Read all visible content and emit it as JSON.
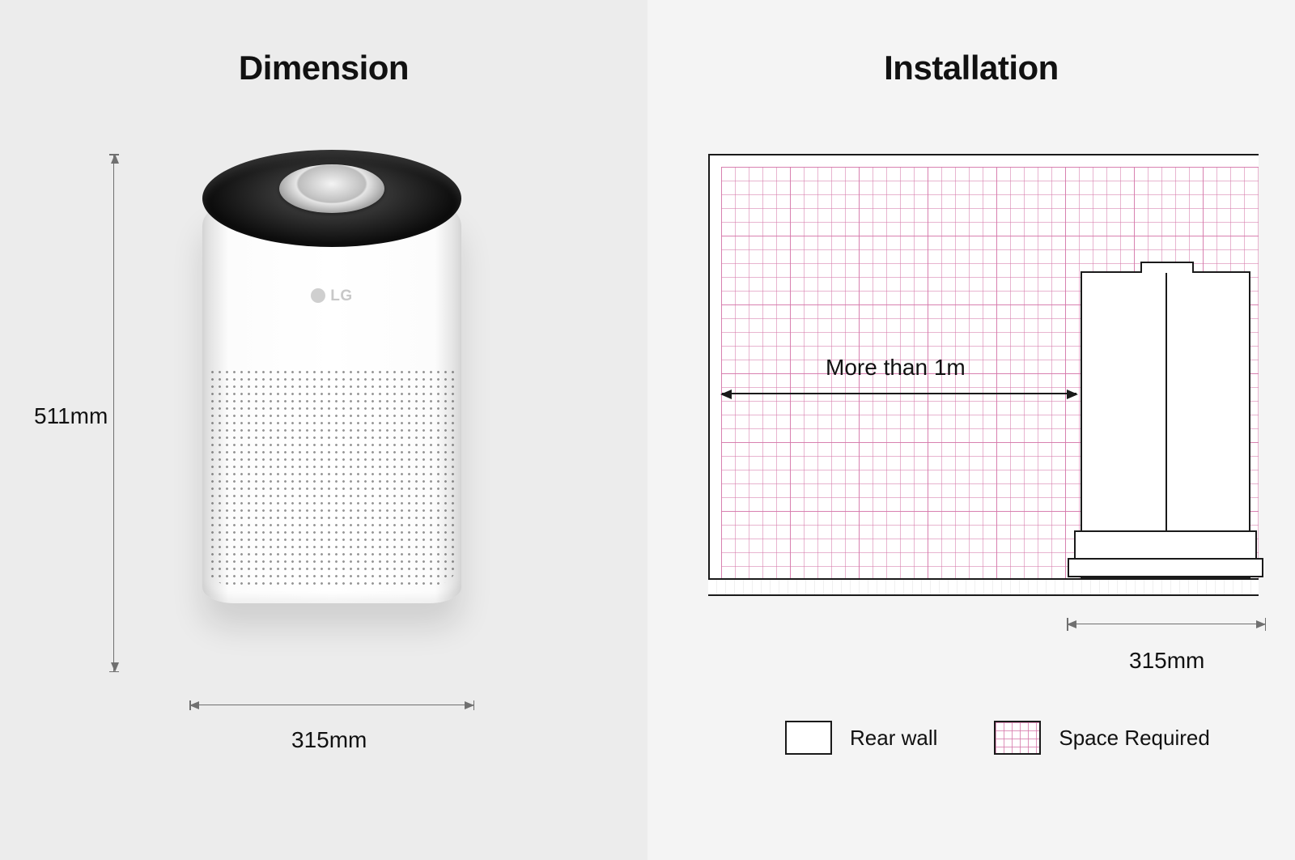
{
  "left": {
    "title": "Dimension",
    "height_label": "511mm",
    "width_label": "315mm",
    "brand": "LG"
  },
  "right": {
    "title": "Installation",
    "clearance_label": "More than 1m",
    "device_width_label": "315mm",
    "legend": {
      "rear_wall": "Rear wall",
      "space_required": "Space Required"
    }
  }
}
